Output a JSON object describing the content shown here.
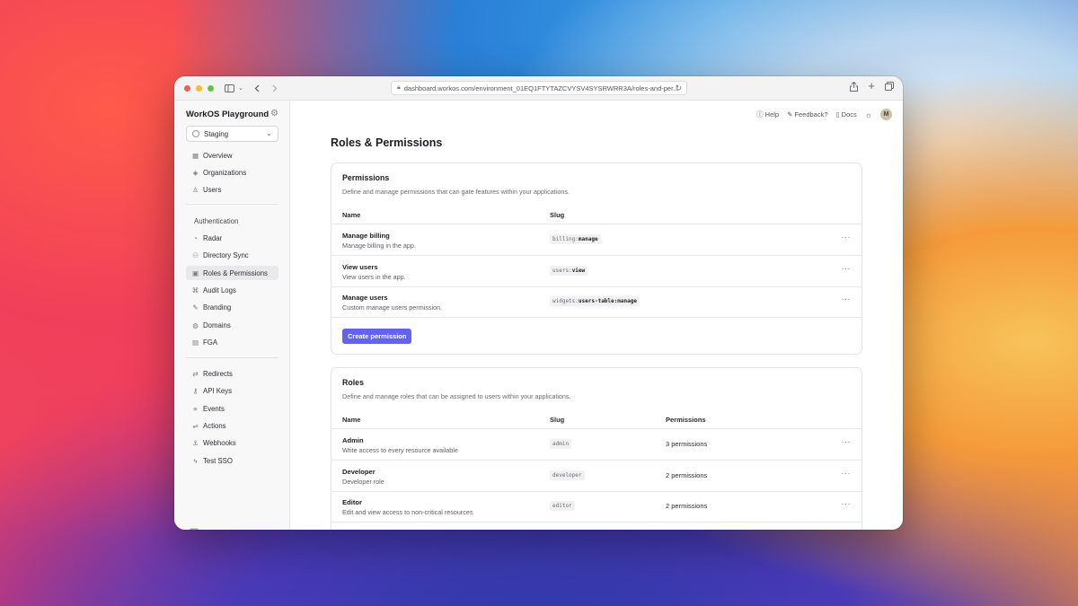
{
  "browser": {
    "url": "dashboard.workos.com/environment_01EQ1FTYTAZCVYSV4SYSRWRR3A/roles-and-per..."
  },
  "sidebar": {
    "title": "WorkOS Playground",
    "environment": "Staging",
    "items_top": [
      {
        "label": "Overview",
        "icon": "grid-icon"
      },
      {
        "label": "Organizations",
        "icon": "layers-icon"
      },
      {
        "label": "Users",
        "icon": "user-icon"
      }
    ],
    "section_label": "Authentication",
    "items_auth": [
      {
        "label": "Radar",
        "icon": "radar-icon"
      },
      {
        "label": "Directory Sync",
        "icon": "users-sync-icon"
      },
      {
        "label": "Roles & Permissions",
        "icon": "roles-icon",
        "active": true
      },
      {
        "label": "Audit Logs",
        "icon": "audit-icon"
      },
      {
        "label": "Branding",
        "icon": "brush-icon"
      },
      {
        "label": "Domains",
        "icon": "globe-icon"
      },
      {
        "label": "FGA",
        "icon": "fga-icon"
      }
    ],
    "items_dev": [
      {
        "label": "Redirects",
        "icon": "link-icon"
      },
      {
        "label": "API Keys",
        "icon": "key-icon"
      },
      {
        "label": "Events",
        "icon": "events-icon"
      },
      {
        "label": "Actions",
        "icon": "actions-icon"
      },
      {
        "label": "Webhooks",
        "icon": "webhook-icon"
      },
      {
        "label": "Test SSO",
        "icon": "bolt-icon"
      }
    ]
  },
  "topbar": {
    "help": "Help",
    "feedback": "Feedback?",
    "docs": "Docs",
    "avatar": "M"
  },
  "page": {
    "title": "Roles & Permissions"
  },
  "permissions": {
    "title": "Permissions",
    "description": "Define and manage permissions that can gate features within your applications.",
    "col_name": "Name",
    "col_slug": "Slug",
    "rows": [
      {
        "name": "Manage billing",
        "desc": "Manage billing in the app.",
        "slug_prefix": "billing:",
        "slug_action": "manage"
      },
      {
        "name": "View users",
        "desc": "View users in the app.",
        "slug_prefix": "users:",
        "slug_action": "view"
      },
      {
        "name": "Manage users",
        "desc": "Custom manage users permission.",
        "slug_prefix": "widgets:",
        "slug_action": "users-table:manage"
      }
    ],
    "create_button": "Create permission"
  },
  "roles": {
    "title": "Roles",
    "description": "Define and manage roles that can be assigned to users within your applications.",
    "col_name": "Name",
    "col_slug": "Slug",
    "col_permissions": "Permissions",
    "rows": [
      {
        "name": "Admin",
        "desc": "Write access to every resource available",
        "slug": "admin",
        "permissions": "3 permissions"
      },
      {
        "name": "Developer",
        "desc": "Developer role",
        "slug": "developer",
        "permissions": "2 permissions"
      },
      {
        "name": "Editor",
        "desc": "Edit and view access to non-critical resources",
        "slug": "editor",
        "permissions": "2 permissions"
      }
    ]
  },
  "more_glyph": "···"
}
